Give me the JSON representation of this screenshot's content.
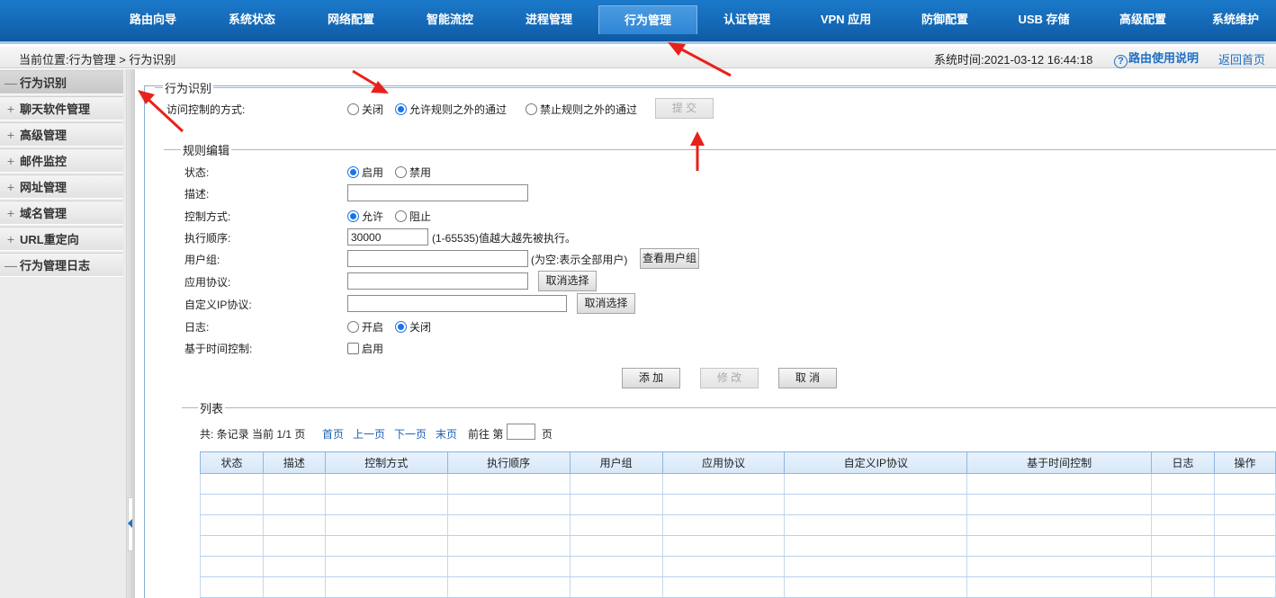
{
  "topnav": {
    "items": [
      "路由向导",
      "系统状态",
      "网络配置",
      "智能流控",
      "进程管理",
      "行为管理",
      "认证管理",
      "VPN 应用",
      "防御配置",
      "USB 存储",
      "高级配置",
      "系统维护"
    ],
    "active": "行为管理"
  },
  "header": {
    "breadcrumb": "当前位置:行为管理 > 行为识别",
    "system_time": "系统时间:2021-03-12 16:44:18",
    "help_link": "路由使用说明",
    "home_link": "返回首页"
  },
  "sidebar": {
    "items": [
      {
        "sign": "—",
        "label": "行为识别"
      },
      {
        "sign": "+",
        "label": "聊天软件管理"
      },
      {
        "sign": "+",
        "label": "高级管理"
      },
      {
        "sign": "+",
        "label": "邮件监控"
      },
      {
        "sign": "+",
        "label": "网址管理"
      },
      {
        "sign": "+",
        "label": "域名管理"
      },
      {
        "sign": "+",
        "label": "URL重定向"
      },
      {
        "sign": "—",
        "label": "行为管理日志"
      }
    ]
  },
  "recognition": {
    "legend": "行为识别",
    "mode_label": "访问控制的方式:",
    "options": [
      "关闭",
      "允许规则之外的通过",
      "禁止规则之外的通过"
    ],
    "selected": "允许规则之外的通过",
    "submit": "提 交"
  },
  "rule_edit": {
    "legend": "规则编辑",
    "status_label": "状态:",
    "status_options": [
      "启用",
      "禁用"
    ],
    "desc_label": "描述:",
    "control_label": "控制方式:",
    "control_options": [
      "允许",
      "阻止"
    ],
    "order_label": "执行顺序:",
    "order_value": "30000",
    "order_hint": "(1-65535)值越大越先被执行。",
    "group_label": "用户组:",
    "group_hint": "(为空:表示全部用户)",
    "view_groups": "查看用户组",
    "app_label": "应用协议:",
    "cancel_select": "取消选择",
    "ip_label": "自定义IP协议:",
    "log_label": "日志:",
    "log_options": [
      "开启",
      "关闭"
    ],
    "time_label": "基于时间控制:",
    "time_option": "启用",
    "add": "添 加",
    "modify": "修 改",
    "cancel": "取 消"
  },
  "list": {
    "legend": "列表",
    "summary": "共: 条记录 当前 1/1 页",
    "first": "首页",
    "prev": "上一页",
    "next": "下一页",
    "last": "末页",
    "goto": "前往 第",
    "page_suffix": "页",
    "columns": [
      "状态",
      "描述",
      "控制方式",
      "执行顺序",
      "用户组",
      "应用协议",
      "自定义IP协议",
      "基于时间控制",
      "日志",
      "操作"
    ]
  },
  "colors": {
    "nav": "#1468b5",
    "accent": "#1a73e8",
    "annotation": "#e8221b"
  }
}
